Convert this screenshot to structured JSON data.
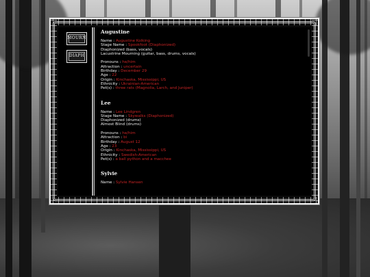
{
  "characters": [
    {
      "name": "Augustine",
      "lines_a": [
        {
          "label": "Name : ",
          "value": "Augustine Kolking"
        },
        {
          "label": "Stage Name : ",
          "value": "Spookfoot (Diaphonized)"
        },
        {
          "label": "Diaphonized (bass, vocals)",
          "value": ""
        },
        {
          "label": "Lacustrine Mourning (guitar, bass, drums, vocals)",
          "value": ""
        }
      ],
      "lines_b": [
        {
          "label": "Pronouns : ",
          "value": "he/him"
        },
        {
          "label": "Attraction : ",
          "value": "uncertain"
        },
        {
          "label": "Birthday : ",
          "value": "December 29"
        },
        {
          "label": "Age : ",
          "value": "22"
        },
        {
          "label": "Origin : ",
          "value": "Kinchaska, Mississippi, US"
        },
        {
          "label": "Ethnicity : ",
          "value": "Ukrainian-American"
        },
        {
          "label": "Pet(s) : ",
          "value": "three rats (Magnolia, Larch, and Juniper)"
        }
      ]
    },
    {
      "name": "Lee",
      "lines_a": [
        {
          "label": "Name : ",
          "value": "Lee Lindgren"
        },
        {
          "label": "Stage Name : ",
          "value": "Skywalks (Diaphonized)"
        },
        {
          "label": "Diaphonized (drums)",
          "value": ""
        },
        {
          "label": "Almost Blind (drums)",
          "value": ""
        }
      ],
      "lines_b": [
        {
          "label": "Pronouns : ",
          "value": "he/him"
        },
        {
          "label": "Attraction : ",
          "value": "bi"
        },
        {
          "label": "Birthday : ",
          "value": "August 12"
        },
        {
          "label": "Age : ",
          "value": "23"
        },
        {
          "label": "Origin : ",
          "value": "Kinchaska, Mississippi, US"
        },
        {
          "label": "Ethnicity : ",
          "value": "Swedish-American"
        },
        {
          "label": "Pet(s) : ",
          "value": "a ball python and a macchee"
        }
      ]
    },
    {
      "name": "Sylvie",
      "lines_a": [
        {
          "label": "Name : ",
          "value": "Sylvie Hansen"
        }
      ],
      "lines_b": []
    }
  ],
  "sidebar": {
    "badges": [
      {
        "text": "MOURN"
      },
      {
        "text": "DIAPH"
      }
    ]
  }
}
